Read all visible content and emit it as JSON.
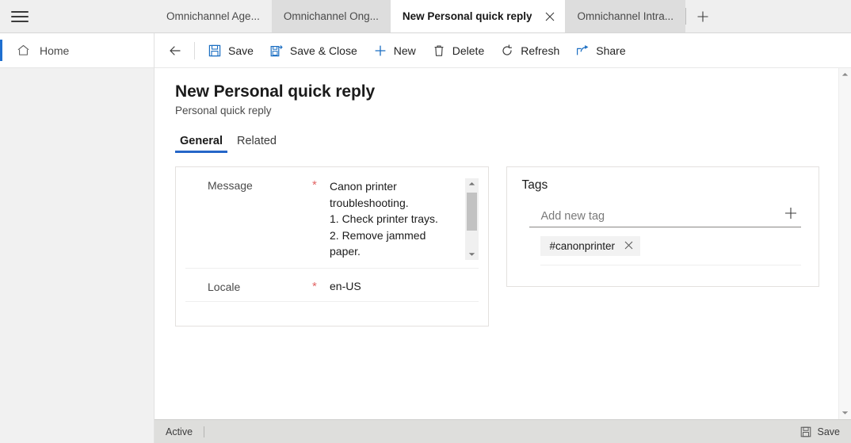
{
  "browser": {
    "menu_icon": "hamburger-icon",
    "new_tab_icon": "plus-icon",
    "tabs": [
      {
        "label": "Omnichannel Age...",
        "active": false,
        "shade": "a"
      },
      {
        "label": "Omnichannel Ong...",
        "active": false,
        "shade": "b"
      },
      {
        "label": "New Personal quick reply",
        "active": true,
        "shade": "active",
        "close_icon": "close-icon"
      },
      {
        "label": "Omnichannel Intra...",
        "active": false,
        "shade": "b"
      }
    ]
  },
  "sidebar": {
    "items": [
      {
        "label": "Home",
        "icon": "home-icon",
        "selected": true
      }
    ]
  },
  "commandbar": {
    "back_icon": "arrow-left-icon",
    "buttons": [
      {
        "label": "Save",
        "icon": "save-icon"
      },
      {
        "label": "Save & Close",
        "icon": "save-and-close-icon"
      },
      {
        "label": "New",
        "icon": "plus-icon"
      },
      {
        "label": "Delete",
        "icon": "trash-icon"
      },
      {
        "label": "Refresh",
        "icon": "refresh-icon"
      },
      {
        "label": "Share",
        "icon": "share-icon"
      }
    ]
  },
  "record": {
    "title": "New Personal quick reply",
    "subtitle": "Personal quick reply",
    "tabs": [
      {
        "label": "General",
        "selected": true
      },
      {
        "label": "Related",
        "selected": false
      }
    ]
  },
  "form": {
    "message_field": {
      "label": "Message",
      "required_marker": "*",
      "value": "Canon printer\ntroubleshooting.\n1. Check printer trays.\n2. Remove jammed\npaper.",
      "scroll_up_icon": "chevron-up-icon",
      "scroll_down_icon": "chevron-down-icon"
    },
    "locale_field": {
      "label": "Locale",
      "required_marker": "*",
      "value": "en-US"
    }
  },
  "tags_panel": {
    "heading": "Tags",
    "input_placeholder": "Add new tag",
    "input_value": "",
    "add_icon": "plus-icon",
    "chips": [
      {
        "label": "#canonprinter",
        "remove_icon": "close-icon"
      }
    ]
  },
  "page_scrollbar": {
    "up_icon": "chevron-up-icon",
    "down_icon": "chevron-down-icon"
  },
  "statusbar": {
    "state": "Active",
    "save_label": "Save",
    "save_icon": "save-icon"
  },
  "colors": {
    "accent_blue": "#2566c8",
    "nav_accent": "#1f6fd0",
    "required_red": "#e26464",
    "icon_blue": "#1b6ec2",
    "active_tab_bg": "#ffffff",
    "statusbar_bg": "#dededc"
  }
}
